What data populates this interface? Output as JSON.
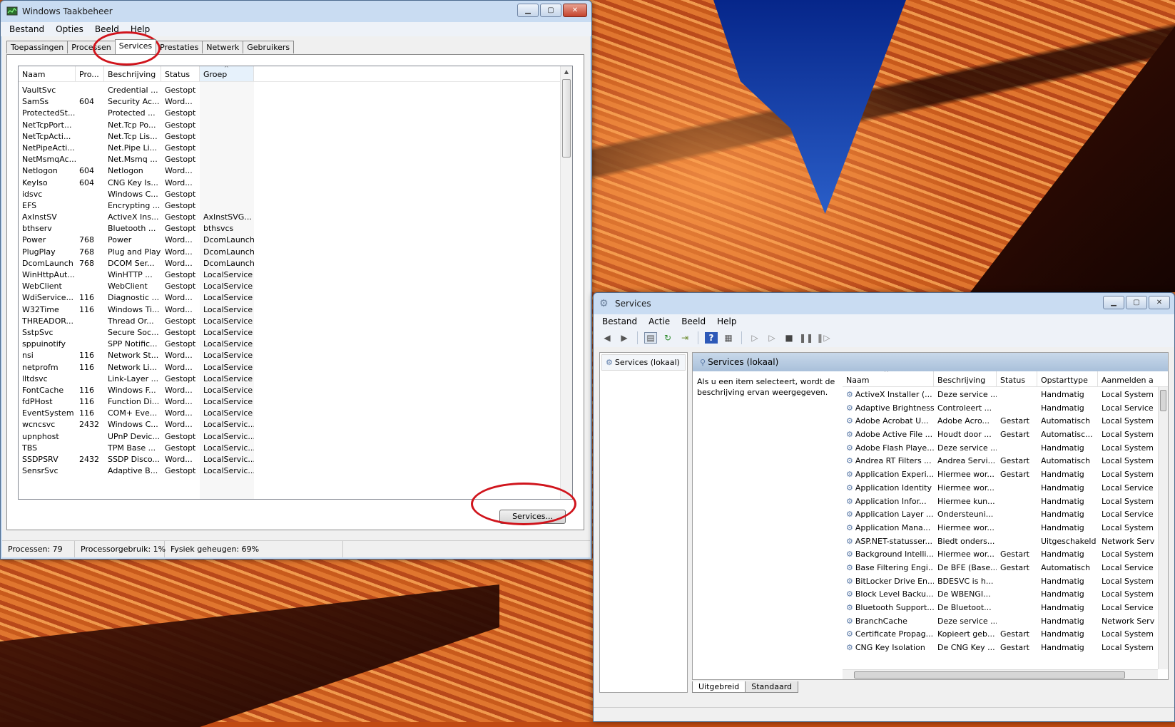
{
  "taskmgr": {
    "title": "Windows Taakbeheer",
    "menu": [
      "Bestand",
      "Opties",
      "Beeld",
      "Help"
    ],
    "tabs": [
      "Toepassingen",
      "Processen",
      "Services",
      "Prestaties",
      "Netwerk",
      "Gebruikers"
    ],
    "columns": [
      "Naam",
      "Pro...",
      "Beschrijving",
      "Status",
      "Groep"
    ],
    "rows": [
      [
        "VaultSvc",
        "",
        "Credential ...",
        "Gestopt",
        ""
      ],
      [
        "SamSs",
        "604",
        "Security Ac...",
        "Word...",
        ""
      ],
      [
        "ProtectedSt...",
        "",
        "Protected ...",
        "Gestopt",
        ""
      ],
      [
        "NetTcpPort...",
        "",
        "Net.Tcp Po...",
        "Gestopt",
        ""
      ],
      [
        "NetTcpActi...",
        "",
        "Net.Tcp Lis...",
        "Gestopt",
        ""
      ],
      [
        "NetPipeActi...",
        "",
        "Net.Pipe Li...",
        "Gestopt",
        ""
      ],
      [
        "NetMsmqAc...",
        "",
        "Net.Msmq ...",
        "Gestopt",
        ""
      ],
      [
        "Netlogon",
        "604",
        "Netlogon",
        "Word...",
        ""
      ],
      [
        "KeyIso",
        "604",
        "CNG Key Is...",
        "Word...",
        ""
      ],
      [
        "idsvc",
        "",
        "Windows C...",
        "Gestopt",
        ""
      ],
      [
        "EFS",
        "",
        "Encrypting ...",
        "Gestopt",
        ""
      ],
      [
        "AxInstSV",
        "",
        "ActiveX Ins...",
        "Gestopt",
        "AxInstSVG..."
      ],
      [
        "bthserv",
        "",
        "Bluetooth ...",
        "Gestopt",
        "bthsvcs"
      ],
      [
        "Power",
        "768",
        "Power",
        "Word...",
        "DcomLaunch"
      ],
      [
        "PlugPlay",
        "768",
        "Plug and Play",
        "Word...",
        "DcomLaunch"
      ],
      [
        "DcomLaunch",
        "768",
        "DCOM Ser...",
        "Word...",
        "DcomLaunch"
      ],
      [
        "WinHttpAut...",
        "",
        "WinHTTP ...",
        "Gestopt",
        "LocalService"
      ],
      [
        "WebClient",
        "",
        "WebClient",
        "Gestopt",
        "LocalService"
      ],
      [
        "WdiService...",
        "116",
        "Diagnostic ...",
        "Word...",
        "LocalService"
      ],
      [
        "W32Time",
        "116",
        "Windows Ti...",
        "Word...",
        "LocalService"
      ],
      [
        "THREADOR...",
        "",
        "Thread Or...",
        "Gestopt",
        "LocalService"
      ],
      [
        "SstpSvc",
        "",
        "Secure Soc...",
        "Gestopt",
        "LocalService"
      ],
      [
        "sppuinotify",
        "",
        "SPP Notific...",
        "Gestopt",
        "LocalService"
      ],
      [
        "nsi",
        "116",
        "Network St...",
        "Word...",
        "LocalService"
      ],
      [
        "netprofm",
        "116",
        "Network Li...",
        "Word...",
        "LocalService"
      ],
      [
        "lltdsvc",
        "",
        "Link-Layer ...",
        "Gestopt",
        "LocalService"
      ],
      [
        "FontCache",
        "116",
        "Windows F...",
        "Word...",
        "LocalService"
      ],
      [
        "fdPHost",
        "116",
        "Function Di...",
        "Word...",
        "LocalService"
      ],
      [
        "EventSystem",
        "116",
        "COM+ Eve...",
        "Word...",
        "LocalService"
      ],
      [
        "wcncsvc",
        "2432",
        "Windows C...",
        "Word...",
        "LocalServic..."
      ],
      [
        "upnphost",
        "",
        "UPnP Devic...",
        "Gestopt",
        "LocalServic..."
      ],
      [
        "TBS",
        "",
        "TPM Base ...",
        "Gestopt",
        "LocalServic..."
      ],
      [
        "SSDPSRV",
        "2432",
        "SSDP Disco...",
        "Word...",
        "LocalServic..."
      ],
      [
        "SensrSvc",
        "",
        "Adaptive B...",
        "Gestopt",
        "LocalServic..."
      ]
    ],
    "services_button": "Services...",
    "status": {
      "processes": "Processen: 79",
      "cpu": "Processorgebruik: 1%",
      "memory": "Fysiek geheugen: 69%"
    }
  },
  "services": {
    "title": "Services",
    "menu": [
      "Bestand",
      "Actie",
      "Beeld",
      "Help"
    ],
    "tree_item": "Services (lokaal)",
    "pane_title": "Services (lokaal)",
    "description": "Als u een item selecteert, wordt de beschrijving ervan weergegeven.",
    "columns": [
      "Naam",
      "Beschrijving",
      "Status",
      "Opstarttype",
      "Aanmelden a"
    ],
    "rows": [
      [
        "ActiveX Installer (...",
        "Deze service ...",
        "",
        "Handmatig",
        "Local System"
      ],
      [
        "Adaptive Brightness",
        "Controleert ...",
        "",
        "Handmatig",
        "Local Service"
      ],
      [
        "Adobe Acrobat U...",
        "Adobe Acro...",
        "Gestart",
        "Automatisch",
        "Local System"
      ],
      [
        "Adobe Active File ...",
        "Houdt door ...",
        "Gestart",
        "Automatisc...",
        "Local System"
      ],
      [
        "Adobe Flash Playe...",
        "Deze service ...",
        "",
        "Handmatig",
        "Local System"
      ],
      [
        "Andrea RT Filters ...",
        "Andrea Servi...",
        "Gestart",
        "Automatisch",
        "Local System"
      ],
      [
        "Application Experi...",
        "Hiermee wor...",
        "Gestart",
        "Handmatig",
        "Local System"
      ],
      [
        "Application Identity",
        "Hiermee wor...",
        "",
        "Handmatig",
        "Local Service"
      ],
      [
        "Application Infor...",
        "Hiermee kun...",
        "",
        "Handmatig",
        "Local System"
      ],
      [
        "Application Layer ...",
        "Ondersteuni...",
        "",
        "Handmatig",
        "Local Service"
      ],
      [
        "Application Mana...",
        "Hiermee wor...",
        "",
        "Handmatig",
        "Local System"
      ],
      [
        "ASP.NET-statusser...",
        "Biedt onders...",
        "",
        "Uitgeschakeld",
        "Network Serv"
      ],
      [
        "Background Intelli...",
        "Hiermee wor...",
        "Gestart",
        "Handmatig",
        "Local System"
      ],
      [
        "Base Filtering Engi...",
        "De BFE (Base...",
        "Gestart",
        "Automatisch",
        "Local Service"
      ],
      [
        "BitLocker Drive En...",
        "BDESVC is h...",
        "",
        "Handmatig",
        "Local System"
      ],
      [
        "Block Level Backu...",
        "De WBENGI...",
        "",
        "Handmatig",
        "Local System"
      ],
      [
        "Bluetooth Support...",
        "De Bluetoot...",
        "",
        "Handmatig",
        "Local Service"
      ],
      [
        "BranchCache",
        "Deze service ...",
        "",
        "Handmatig",
        "Network Serv"
      ],
      [
        "Certificate Propag...",
        "Kopieert geb...",
        "Gestart",
        "Handmatig",
        "Local System"
      ],
      [
        "CNG Key Isolation",
        "De CNG Key ...",
        "Gestart",
        "Handmatig",
        "Local System"
      ]
    ],
    "bottom_tabs": [
      "Uitgebreid",
      "Standaard"
    ]
  },
  "colors": {
    "highlight_ellipse": "#d0141c",
    "title_bar": "#c9dcf2"
  }
}
